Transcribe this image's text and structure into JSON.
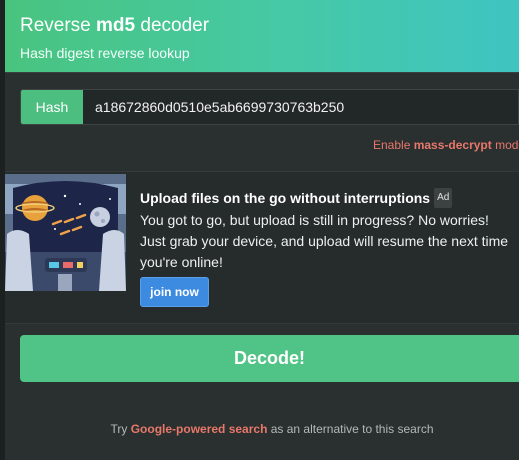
{
  "header": {
    "title_prefix": "Reverse ",
    "title_bold": "md5",
    "title_suffix": " decoder",
    "subtitle": "Hash digest reverse lookup"
  },
  "form": {
    "hash_label": "Hash",
    "hash_value": "a18672860d0510e5ab6699730763b250",
    "mass_prefix": "Enable ",
    "mass_bold": "mass-decrypt",
    "mass_suffix": " mode",
    "decode_label": "Decode!"
  },
  "ad": {
    "headline": "Upload files on the go without interruptions",
    "badge": "Ad",
    "body": "You got to go, but upload is still in progress? No worries! Just grab your device, and upload will resume the next time you're online!",
    "cta": "join now"
  },
  "alternative": {
    "prefix": "Try ",
    "link": "Google-powered search",
    "suffix": " as an alternative to this search"
  },
  "colors": {
    "accent_green": "#4cbe7f",
    "header_teal": "#3fc4c2",
    "link_salmon": "#e7786a",
    "cta_blue": "#3d8be0",
    "background": "#262b2b"
  }
}
